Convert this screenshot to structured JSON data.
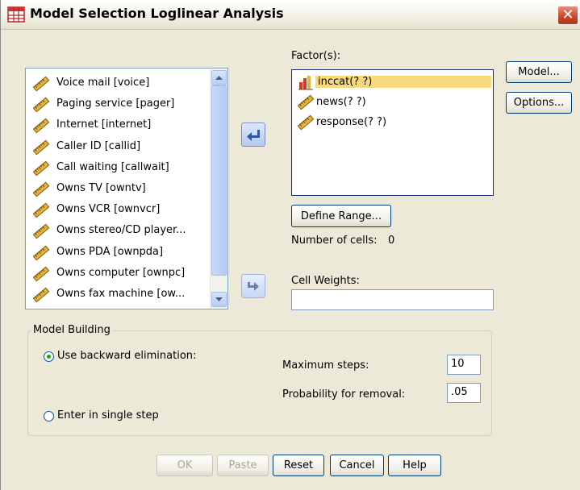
{
  "window": {
    "title": "Model Selection Loglinear Analysis",
    "close_glyph": "✕"
  },
  "variables": [
    "Voice mail [voice]",
    "Paging service [pager]",
    "Internet [internet]",
    "Caller ID [callid]",
    "Call waiting [callwait]",
    "Owns TV [owntv]",
    "Owns VCR [ownvcr]",
    "Owns stereo/CD player...",
    "Owns PDA [ownpda]",
    "Owns computer [ownpc]",
    "Owns fax machine [ow..."
  ],
  "factors": {
    "label": "Factor(s):",
    "items": [
      "inccat(? ?)",
      "news(? ?)",
      "response(? ?)"
    ],
    "selected_index": 0
  },
  "define_range_label": "Define Range...",
  "number_of_cells": {
    "label": "Number of cells:",
    "value": "0"
  },
  "cell_weights": {
    "label": "Cell Weights:",
    "value": ""
  },
  "side_buttons": {
    "model": "Model...",
    "options": "Options..."
  },
  "model_building": {
    "title": "Model Building",
    "backward": {
      "label": "Use backward elimination:",
      "selected": true
    },
    "single": {
      "label": "Enter in single step",
      "selected": false
    },
    "max_steps": {
      "label": "Maximum steps:",
      "value": "10"
    },
    "prob_removal": {
      "label": "Probability for removal:",
      "value": ".05"
    }
  },
  "bottom_buttons": {
    "ok": "OK",
    "paste": "Paste",
    "reset": "Reset",
    "cancel": "Cancel",
    "help": "Help"
  },
  "colors": {
    "selection": "#fad87c",
    "ruler_icon": "#d9a520",
    "bar_icon_red": "#d33a1f"
  }
}
